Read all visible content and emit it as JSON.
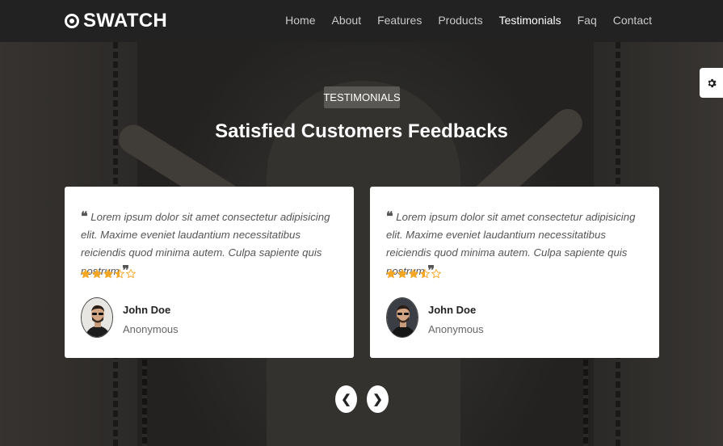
{
  "brand": {
    "name": "SWATCH",
    "icon": "target-icon"
  },
  "nav": {
    "items": [
      {
        "label": "Home",
        "active": false
      },
      {
        "label": "About",
        "active": false
      },
      {
        "label": "Features",
        "active": false
      },
      {
        "label": "Products",
        "active": false
      },
      {
        "label": "Testimonials",
        "active": true
      },
      {
        "label": "Faq",
        "active": false
      },
      {
        "label": "Contact",
        "active": false
      }
    ]
  },
  "settings": {
    "icon": "gear-icon"
  },
  "section": {
    "badge": "TESTIMONIALS",
    "title": "Satisfied Customers Feedbacks"
  },
  "testimonials": [
    {
      "quote": "Lorem ipsum dolor sit amet consectetur adipisicing elit. Maxime eveniet laudantium necessitatibus reiciendis quod minima autem. Culpa sapiente quis nostrum.",
      "rating": 3.5,
      "max_rating": 5,
      "name": "John Doe",
      "role": "Anonymous"
    },
    {
      "quote": "Lorem ipsum dolor sit amet consectetur adipisicing elit. Maxime eveniet laudantium necessitatibus reiciendis quod minima autem. Culpa sapiente quis nostrum.",
      "rating": 3.5,
      "max_rating": 5,
      "name": "John Doe",
      "role": "Anonymous"
    }
  ],
  "carousel": {
    "prev_label": "❮",
    "next_label": "❯"
  },
  "colors": {
    "accent_star": "#f5a623",
    "navbar_bg": "#222222",
    "card_bg": "#ffffff"
  }
}
